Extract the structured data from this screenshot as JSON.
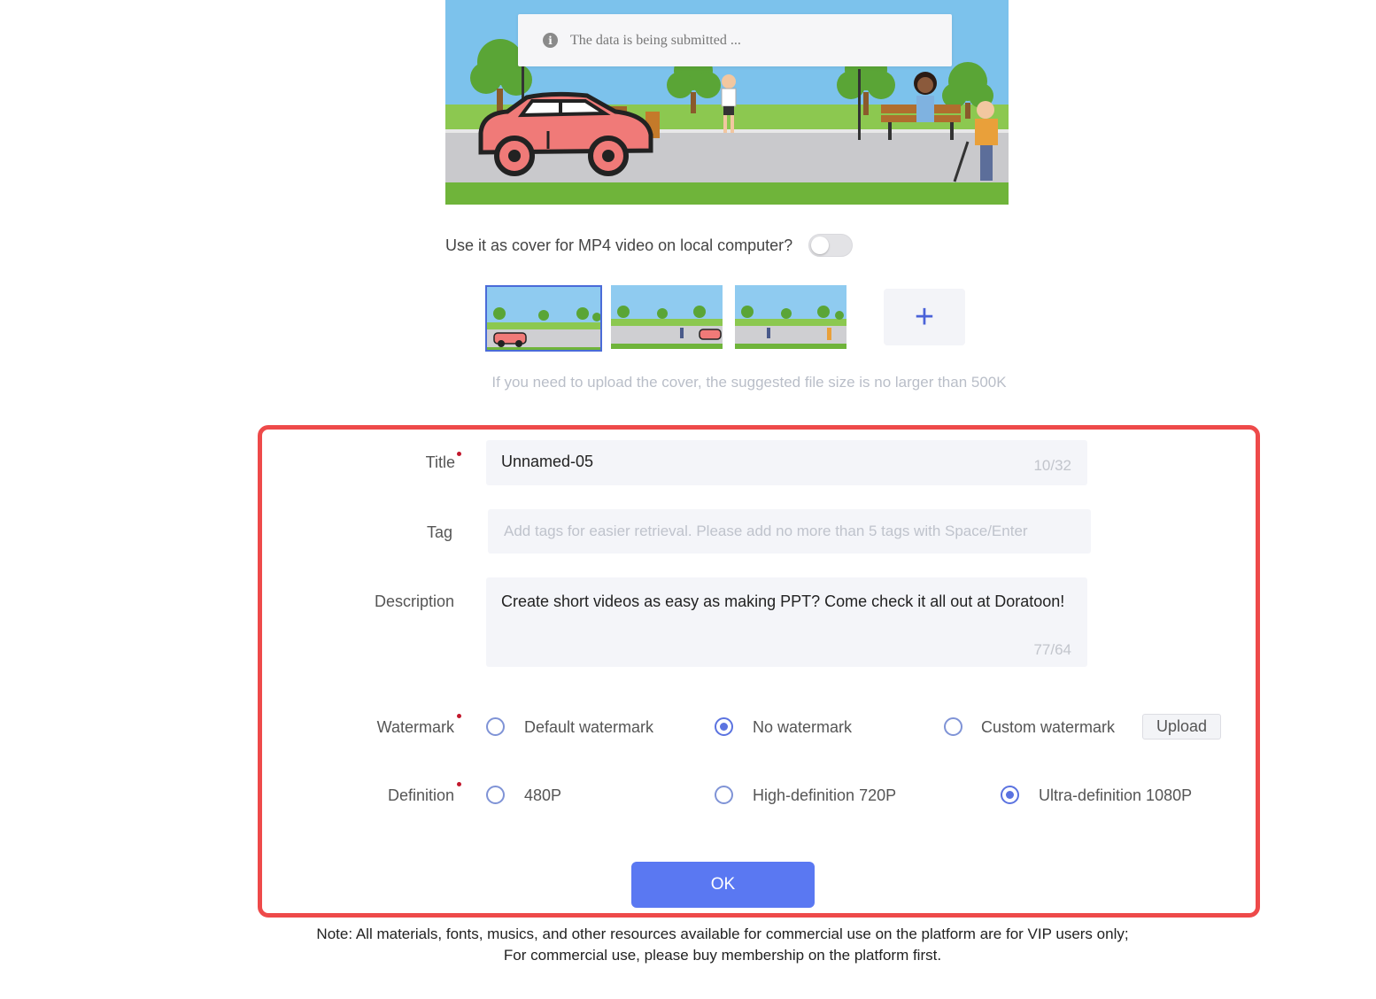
{
  "toast": {
    "icon": "info-icon",
    "text": "The data is being submitted ..."
  },
  "cover": {
    "question": "Use it as cover for MP4 video on local computer?",
    "toggle_on": false,
    "add_symbol": "+",
    "hint": "If you need to upload the cover, the suggested file size is no larger than 500K",
    "selected_thumbnail": 1
  },
  "form": {
    "title": {
      "label": "Title",
      "value": "Unnamed-05",
      "counter": "10/32"
    },
    "tag": {
      "label": "Tag",
      "placeholder": "Add tags for easier retrieval. Please add no more than 5 tags with Space/Enter"
    },
    "description": {
      "label": "Description",
      "value": "Create short videos as easy as making PPT? Come check it all out at Doratoon!",
      "counter": "77/64"
    },
    "watermark": {
      "label": "Watermark",
      "options": [
        "Default watermark",
        "No watermark",
        "Custom watermark"
      ],
      "selected": "No watermark",
      "upload_label": "Upload"
    },
    "definition": {
      "label": "Definition",
      "options": [
        "480P",
        "High-definition 720P",
        "Ultra-definition 1080P"
      ],
      "selected": "Ultra-definition 1080P"
    },
    "ok_label": "OK"
  },
  "note": {
    "line1": "Note: All materials, fonts, musics, and other resources available for commercial use on the platform are for VIP users only;",
    "line2": "For commercial use, please buy membership on the platform first."
  },
  "colors": {
    "accent": "#5a78f2",
    "highlight_border": "#ee4a4a",
    "sky": "#7cc2ec",
    "grass": "#6fb43a",
    "car": "#f07a78"
  }
}
